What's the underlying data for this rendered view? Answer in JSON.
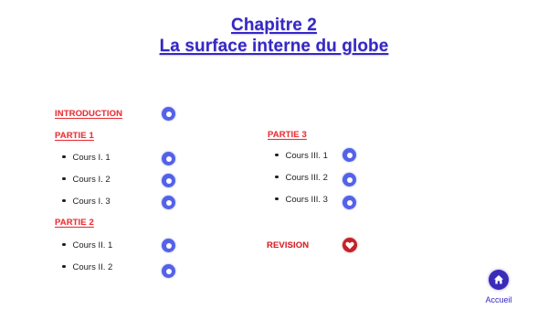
{
  "title": {
    "line1": "Chapitre 2",
    "line2": "La surface interne du globe"
  },
  "menu": {
    "introduction": "INTRODUCTION",
    "partie1": {
      "label": "PARTIE 1",
      "items": [
        "Cours I. 1",
        "Cours I. 2",
        "Cours I. 3"
      ]
    },
    "partie2": {
      "label": "PARTIE 2",
      "items": [
        "Cours II. 1",
        "Cours II. 2"
      ]
    },
    "partie3": {
      "label": "PARTIE 3",
      "items": [
        "Cours III. 1",
        "Cours III. 2",
        "Cours III. 3"
      ]
    },
    "revision": "REVISION"
  },
  "nav": {
    "home_label": "Accueil"
  },
  "colors": {
    "title": "#3528c4",
    "section": "#e8343a",
    "ring_button": "#5462e8",
    "heart_button": "#c4222a",
    "home_button": "#3a2bb8"
  },
  "icons": {
    "course_link": "ring-button-icon",
    "revision_link": "heart-icon",
    "home_link": "home-icon"
  }
}
